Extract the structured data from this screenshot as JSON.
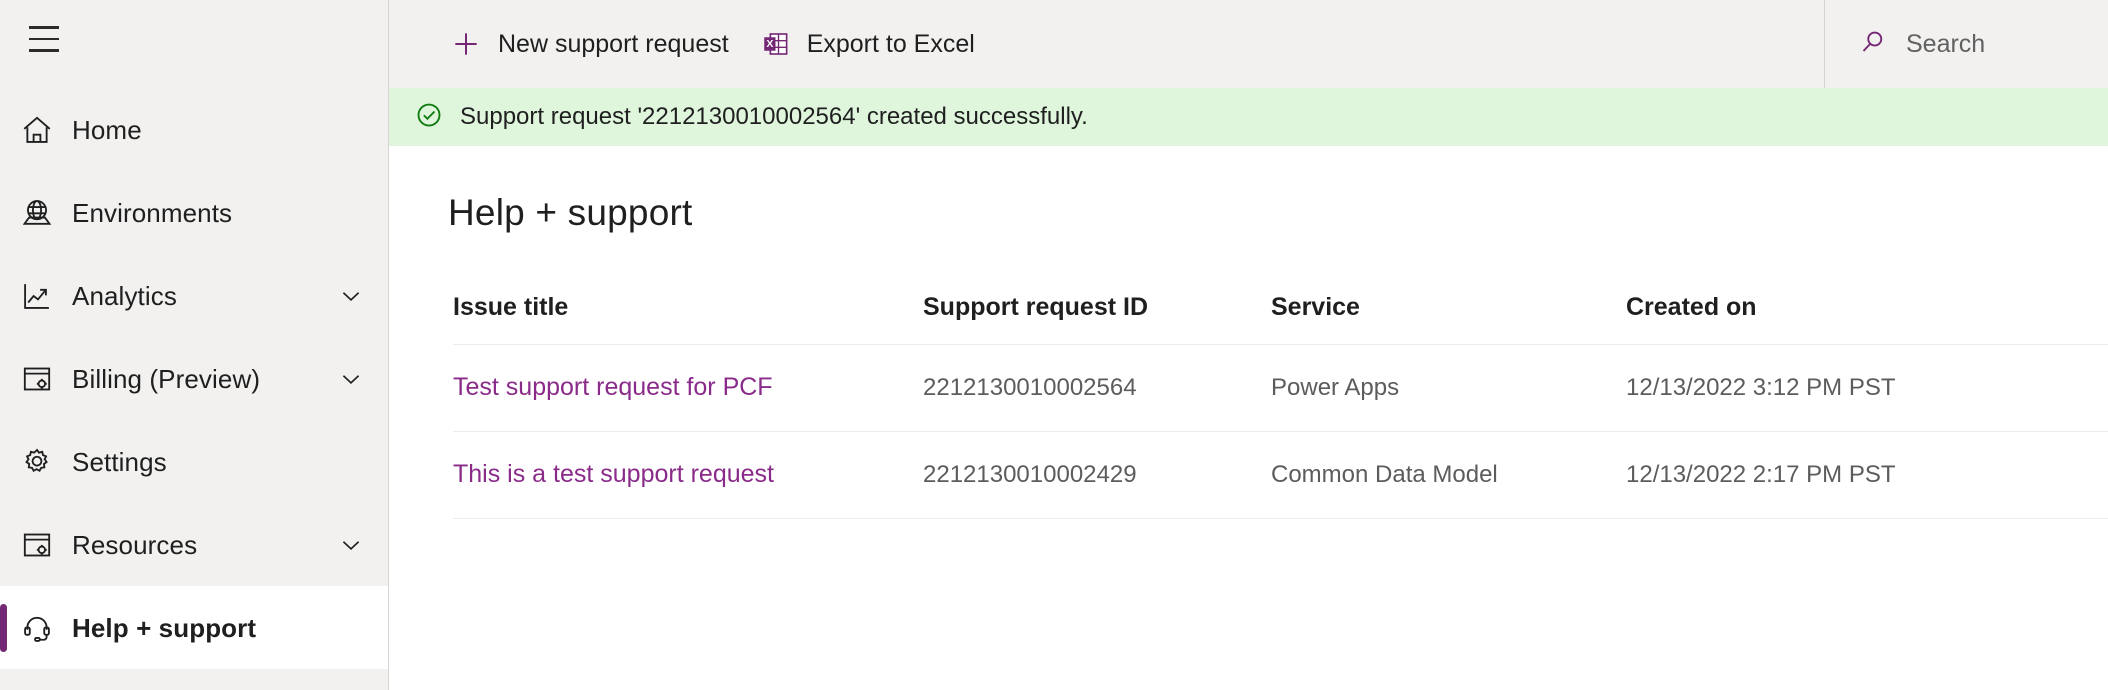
{
  "sidebar": {
    "menu_icon": "hamburger-icon",
    "items": [
      {
        "label": "Home",
        "icon": "home-icon",
        "chevron": false,
        "selected": false
      },
      {
        "label": "Environments",
        "icon": "globe-icon",
        "chevron": false,
        "selected": false
      },
      {
        "label": "Analytics",
        "icon": "analytics-icon",
        "chevron": true,
        "selected": false
      },
      {
        "label": "Billing (Preview)",
        "icon": "billing-icon",
        "chevron": true,
        "selected": false
      },
      {
        "label": "Settings",
        "icon": "gear-icon",
        "chevron": false,
        "selected": false
      },
      {
        "label": "Resources",
        "icon": "resources-icon",
        "chevron": true,
        "selected": false
      },
      {
        "label": "Help + support",
        "icon": "headset-icon",
        "chevron": false,
        "selected": true
      }
    ]
  },
  "commandbar": {
    "new_request_label": "New support request",
    "new_request_icon": "plus-icon",
    "export_label": "Export to Excel",
    "export_icon": "excel-icon"
  },
  "search": {
    "icon": "search-icon",
    "placeholder": "Search",
    "value": ""
  },
  "banner": {
    "icon": "check-circle-icon",
    "message": "Support request '2212130010002564' created successfully.",
    "background": "#dff6dd",
    "icon_color": "#107c10"
  },
  "page": {
    "title": "Help + support"
  },
  "table": {
    "columns": [
      {
        "key": "issue_title",
        "label": "Issue title"
      },
      {
        "key": "request_id",
        "label": "Support request ID"
      },
      {
        "key": "service",
        "label": "Service"
      },
      {
        "key": "created_on",
        "label": "Created on"
      }
    ],
    "rows": [
      {
        "issue_title": "Test support request for PCF",
        "request_id": "2212130010002564",
        "service": "Power Apps",
        "created_on": "12/13/2022 3:12 PM PST"
      },
      {
        "issue_title": "This is a test support request",
        "request_id": "2212130010002429",
        "service": "Common Data Model",
        "created_on": "12/13/2022 2:17 PM PST"
      }
    ]
  },
  "theme": {
    "accent": "#742774",
    "link": "#8a2b8a",
    "sidebar_bg": "#f2f1f0",
    "success_bg": "#dff6dd"
  }
}
